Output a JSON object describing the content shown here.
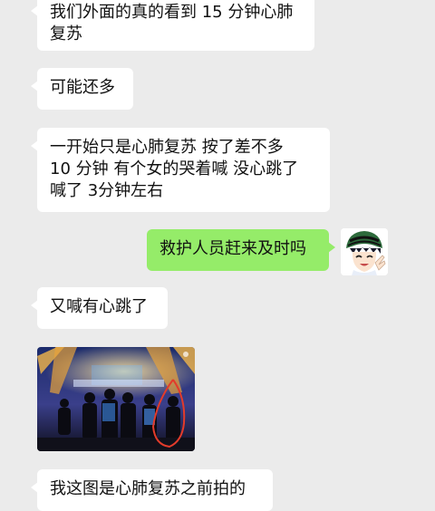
{
  "colors": {
    "background": "#ebebeb",
    "bubble_other": "#ffffff",
    "bubble_self": "#95ec69",
    "text": "#111111"
  },
  "messages": [
    {
      "sender": "other",
      "lines": [
        "我们外面的真的看到 15 分钟心肺",
        "复苏"
      ]
    },
    {
      "sender": "other",
      "lines": [
        "可能还多"
      ]
    },
    {
      "sender": "other",
      "lines": [
        "一开始只是心肺复苏  按了差不多",
        "10 分钟  有个女的哭着喊 没心跳了",
        "喊了 3分钟左右"
      ]
    },
    {
      "sender": "self",
      "lines": [
        "救护人员赶来及时吗"
      ]
    },
    {
      "sender": "other",
      "lines": [
        "又喊有心跳了"
      ]
    },
    {
      "sender": "other",
      "type": "image",
      "image": "stage-photo"
    },
    {
      "sender": "other",
      "lines": [
        "我这图是心肺复苏之前拍的"
      ]
    }
  ],
  "avatar": {
    "icon": "cartoon-boy-avatar-icon"
  }
}
